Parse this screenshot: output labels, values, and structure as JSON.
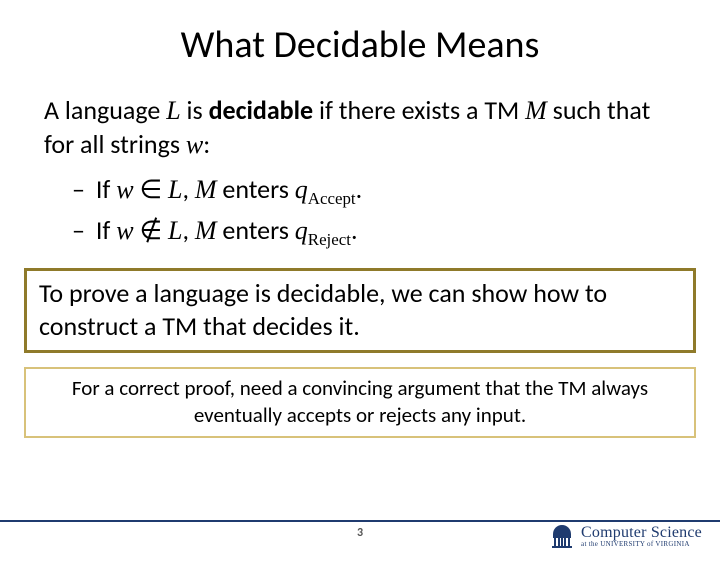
{
  "title": "What Decidable Means",
  "definition": {
    "pre": "A language ",
    "L": "L",
    "mid1": " is ",
    "bold": "decidable",
    "mid2": " if there exists a TM ",
    "M": "M",
    "mid3": " such that for all strings ",
    "w": "w",
    "end": ":"
  },
  "bullet1": {
    "dash": "–",
    "t1": " If ",
    "w": "w",
    "in": " ∈ ",
    "L": "L",
    "comma": ", ",
    "M": "M",
    "enters": " enters ",
    "q": "q",
    "sub": "Accept",
    "dot": "."
  },
  "bullet2": {
    "dash": "–",
    "t1": " If ",
    "w": "w",
    "notin": " ∉ ",
    "L": "L",
    "comma": ", ",
    "M": "M",
    "enters": " enters ",
    "q": "q",
    "sub": "Reject",
    "dot": "."
  },
  "box1": "To prove a language is decidable, we can show how to construct a TM that decides it.",
  "box2": "For a correct proof, need a convincing argument that the TM always eventually accepts or rejects any input.",
  "footer": {
    "page": "3",
    "logo_cs": "Computer Science",
    "logo_uva": "at the UNIVERSITY of VIRGINIA"
  },
  "colors": {
    "accent": "#1f3b6f",
    "box1_border": "#8f7a2a",
    "box2_border": "#d8c27a"
  }
}
